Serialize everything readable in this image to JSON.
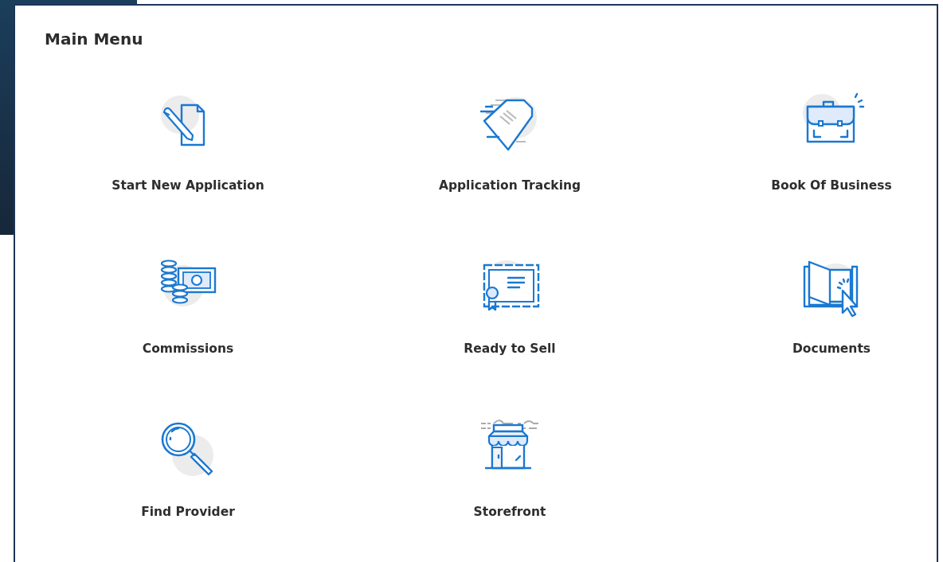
{
  "panel": {
    "title": "Main Menu"
  },
  "menu_items": [
    {
      "label": "Start New Application"
    },
    {
      "label": "Application Tracking"
    },
    {
      "label": "Book Of Business"
    },
    {
      "label": "Commissions"
    },
    {
      "label": "Ready to Sell"
    },
    {
      "label": "Documents"
    },
    {
      "label": "Find Provider"
    },
    {
      "label": "Storefront"
    }
  ]
}
